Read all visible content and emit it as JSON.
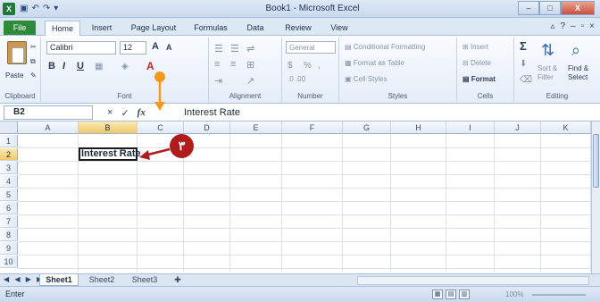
{
  "window": {
    "title": "Book1 - Microsoft Excel",
    "app_icon": "X",
    "qat_icons": [
      "save-icon",
      "undo-icon",
      "redo-icon",
      "customize-icon"
    ],
    "controls": [
      "–",
      "□",
      "X"
    ]
  },
  "ribbon_tabs": {
    "file": "File",
    "items": [
      "Home",
      "Insert",
      "Page Layout",
      "Formulas",
      "Data",
      "Review",
      "View"
    ],
    "active": "Home"
  },
  "ribbon": {
    "clipboard": {
      "label": "Clipboard",
      "paste": "Paste"
    },
    "font": {
      "label": "Font",
      "name": "Calibri",
      "size": "12",
      "grow": "A",
      "shrink": "A",
      "bold": "B",
      "italic": "I",
      "underline": "U"
    },
    "alignment": {
      "label": "Alignment"
    },
    "number": {
      "label": "Number",
      "format": "General",
      "currency": "$",
      "percent": "%",
      "comma": ",",
      "inc_dec": ".0 .00"
    },
    "styles": {
      "label": "Styles",
      "conditional": "Conditional Formatting",
      "table": "Format as Table",
      "cell_styles": "Cell Styles"
    },
    "cells": {
      "label": "Cells",
      "insert": "Insert",
      "delete": "Delete",
      "format": "Format"
    },
    "editing": {
      "label": "Editing",
      "sum": "Σ",
      "sort": "Sort & Filter",
      "find": "Find & Select"
    }
  },
  "formula_bar": {
    "name_box": "B2",
    "cancel": "×",
    "enter": "✓",
    "fx": "fx",
    "content": "Interest Rate"
  },
  "grid": {
    "columns": [
      "A",
      "B",
      "C",
      "D",
      "E",
      "F",
      "G",
      "H",
      "I",
      "J",
      "K"
    ],
    "rows": [
      "1",
      "2",
      "3",
      "4",
      "5",
      "6",
      "7",
      "8",
      "9",
      "10"
    ],
    "selected_column": "B",
    "selected_row": "2",
    "active_cell": {
      "ref": "B2",
      "value": "Interest Rate"
    }
  },
  "sheet_tabs": {
    "nav": "◀ ◀ ▶ ▶",
    "tabs": [
      "Sheet1",
      "Sheet2",
      "Sheet3"
    ],
    "active": "Sheet1"
  },
  "status": {
    "mode": "Enter",
    "zoom": "100%"
  },
  "annotation": {
    "badge": "٣",
    "color": "#b01c1c",
    "pointer_color": "#f39a1a"
  }
}
